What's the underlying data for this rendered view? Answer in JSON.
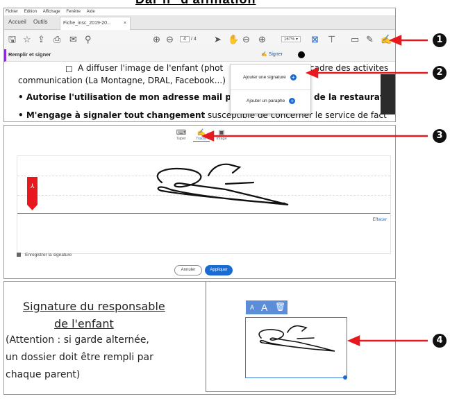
{
  "header_cut_title": "Dar n° d'affiliation",
  "panel1": {
    "menu": [
      "Fichier",
      "Edition",
      "Affichage",
      "Fenêtre",
      "Aide"
    ],
    "tabs": {
      "home": "Accueil",
      "tools": "Outils",
      "document": "Fiche_insc_2019-20..."
    },
    "page": {
      "current": "4",
      "total": "/ 4"
    },
    "zoom": "167%",
    "fill_sign_label": "Remplir et signer",
    "sign_button": "Signer",
    "doc_lines": {
      "l1": "A diffuser l'image de l'enfant (phot",
      "l1b": "cadre des activites",
      "l2": "communication (La Montagne, DRAL, Facebook...)",
      "l3a": "• Autorise l'utilisation de mon adresse mail p",
      "l3b": "de la restauration",
      "l4a": "• M'engage à signaler tout changement",
      "l4b": " susceptible de concerner le service de fact"
    },
    "dropdown": {
      "add_signature": "Ajouter une signature",
      "add_initials": "Ajouter un paraphe"
    }
  },
  "panel2": {
    "modes": {
      "type": "Taper",
      "draw": "Tracer",
      "image": "Image"
    },
    "clear": "Effacer",
    "save_signature": "Enregistrer la signature",
    "cancel": "Annuler",
    "apply": "Appliquer"
  },
  "panel3": {
    "heading1": "Signature du responsable",
    "heading2": "de l'enfant",
    "note1": "(Attention : si garde alternée,",
    "note2": "un dossier doit être rempli par",
    "note3": "chaque parent)",
    "toolbar": {
      "small_a": "A",
      "large_a": "A"
    }
  },
  "callouts": [
    "1",
    "2",
    "3",
    "4"
  ],
  "colors": {
    "arrow": "#e8191e",
    "accent": "#1a6bd1",
    "fill_sign_bar": "#8a2be2"
  },
  "icons": [
    "save-icon",
    "star-icon",
    "upload-icon",
    "print-icon",
    "mail-icon",
    "search-icon",
    "page-up-icon",
    "page-down-icon",
    "select-icon",
    "hand-icon",
    "zoom-out-icon",
    "zoom-in-icon",
    "fit-icon",
    "comment-icon",
    "highlight-icon",
    "sign-icon",
    "trash-icon"
  ]
}
